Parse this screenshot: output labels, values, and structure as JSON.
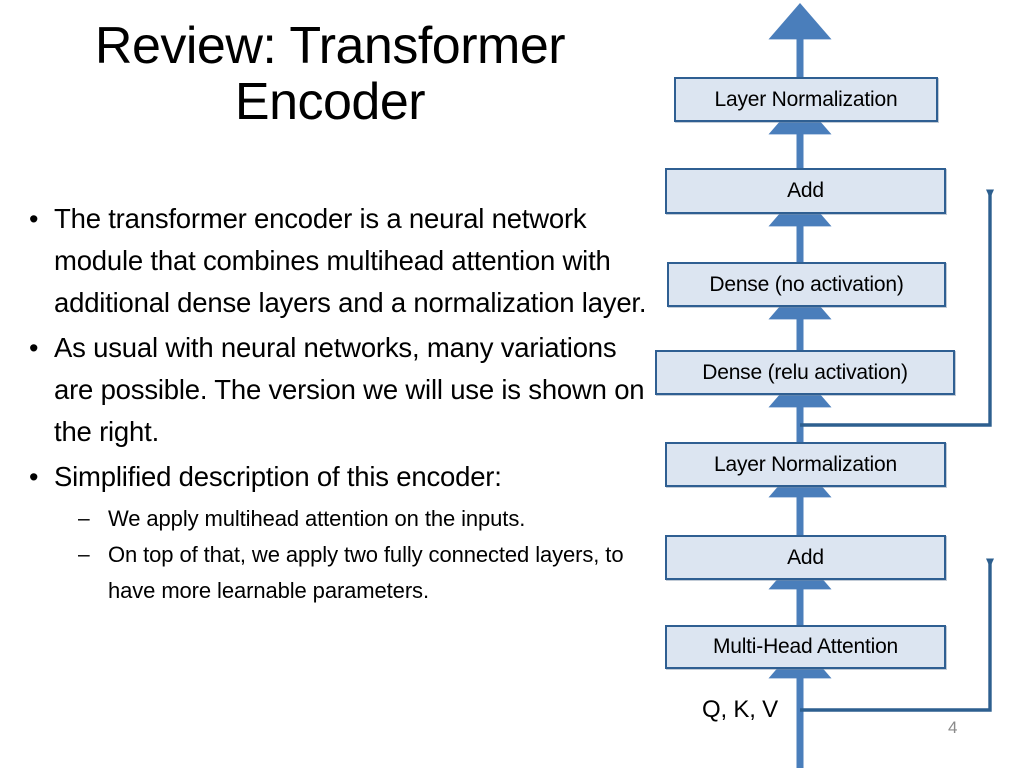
{
  "slide": {
    "title": "Review: Transformer Encoder",
    "page_number": "4",
    "bullet_marker": "•",
    "sub_marker": "–",
    "bullets": [
      "The transformer encoder is a neural network module that combines multihead attention with additional dense layers and a normalization layer.",
      "As usual with neural networks, many variations are possible. The version we will use is shown on the right.",
      "Simplified description of this encoder:"
    ],
    "sub_bullets": [
      "We apply multihead attention on the inputs.",
      "On top of that, we apply two fully connected layers, to have more learnable parameters."
    ]
  },
  "diagram": {
    "input_label": "Q, K, V",
    "nodes": [
      {
        "id": "layer-norm-top",
        "label": "Layer Normalization"
      },
      {
        "id": "add-top",
        "label": "Add"
      },
      {
        "id": "dense-no-activation",
        "label": "Dense (no activation)"
      },
      {
        "id": "dense-relu-activation",
        "label": "Dense (relu activation)"
      },
      {
        "id": "layer-norm-bottom",
        "label": "Layer Normalization"
      },
      {
        "id": "add-bottom",
        "label": "Add"
      },
      {
        "id": "multi-head-attention",
        "label": "Multi-Head Attention"
      }
    ],
    "colors": {
      "node_fill": "#dce5f1",
      "node_border": "#2f5f92",
      "flow_arrow": "#4a7ebb",
      "skip_line": "#2d5f8f",
      "page_number": "#8a8a8a"
    }
  }
}
